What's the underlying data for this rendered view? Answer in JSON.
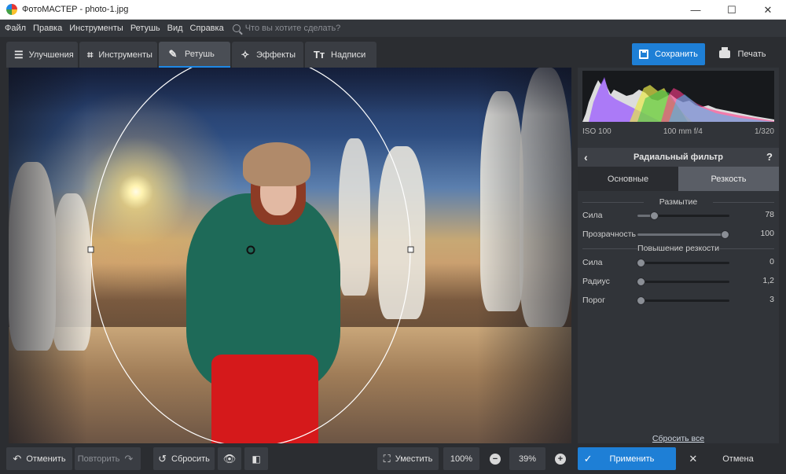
{
  "window": {
    "title": "ФотоМАСТЕР - photo-1.jpg",
    "minimize_glyph": "—",
    "maximize_glyph": "☐",
    "close_glyph": "✕"
  },
  "menu": {
    "items": [
      "Файл",
      "Правка",
      "Инструменты",
      "Ретушь",
      "Вид",
      "Справка"
    ],
    "search_placeholder": "Что вы хотите сделать?"
  },
  "tabs": [
    {
      "label": "Улучшения",
      "icon": "sliders-icon",
      "glyph": "☰",
      "active": false
    },
    {
      "label": "Инструменты",
      "icon": "crop-icon",
      "glyph": "⌗",
      "active": false
    },
    {
      "label": "Ретушь",
      "icon": "brush-icon",
      "glyph": "✎",
      "active": true
    },
    {
      "label": "Эффекты",
      "icon": "magic-wand-icon",
      "glyph": "✧",
      "active": false
    },
    {
      "label": "Надписи",
      "icon": "text-icon",
      "glyph": "Tт",
      "active": false
    }
  ],
  "toolbar": {
    "save_label": "Сохранить",
    "print_label": "Печать",
    "accent": "#1e7fd6"
  },
  "histogram_info": {
    "iso": "ISO 100",
    "lens": "100 mm f/4",
    "shutter": "1/320"
  },
  "panel": {
    "title": "Радиальный фильтр",
    "back_glyph": "‹",
    "help_glyph": "?",
    "subtabs": [
      {
        "label": "Основные",
        "active": false
      },
      {
        "label": "Резкость",
        "active": true
      }
    ],
    "blur_section": "Размытие",
    "sharpen_section": "Повышение резкости",
    "sliders": [
      {
        "label": "Сила",
        "value": "78",
        "fraction": 0.18
      },
      {
        "label": "Прозрачность",
        "value": "100",
        "fraction": 0.95
      },
      {
        "label": "Сила",
        "value": "0",
        "fraction": 0.03
      },
      {
        "label": "Радиус",
        "value": "1,2",
        "fraction": 0.03
      },
      {
        "label": "Порог",
        "value": "3",
        "fraction": 0.03
      }
    ],
    "reset_all": "Сбросить все"
  },
  "bottom": {
    "undo": "Отменить",
    "redo": "Повторить",
    "reset": "Сбросить",
    "fit": "Уместить",
    "zoom_100": "100%",
    "zoom_value": "39%",
    "minus_glyph": "−",
    "plus_glyph": "+",
    "apply": "Применить",
    "cancel": "Отмена"
  }
}
